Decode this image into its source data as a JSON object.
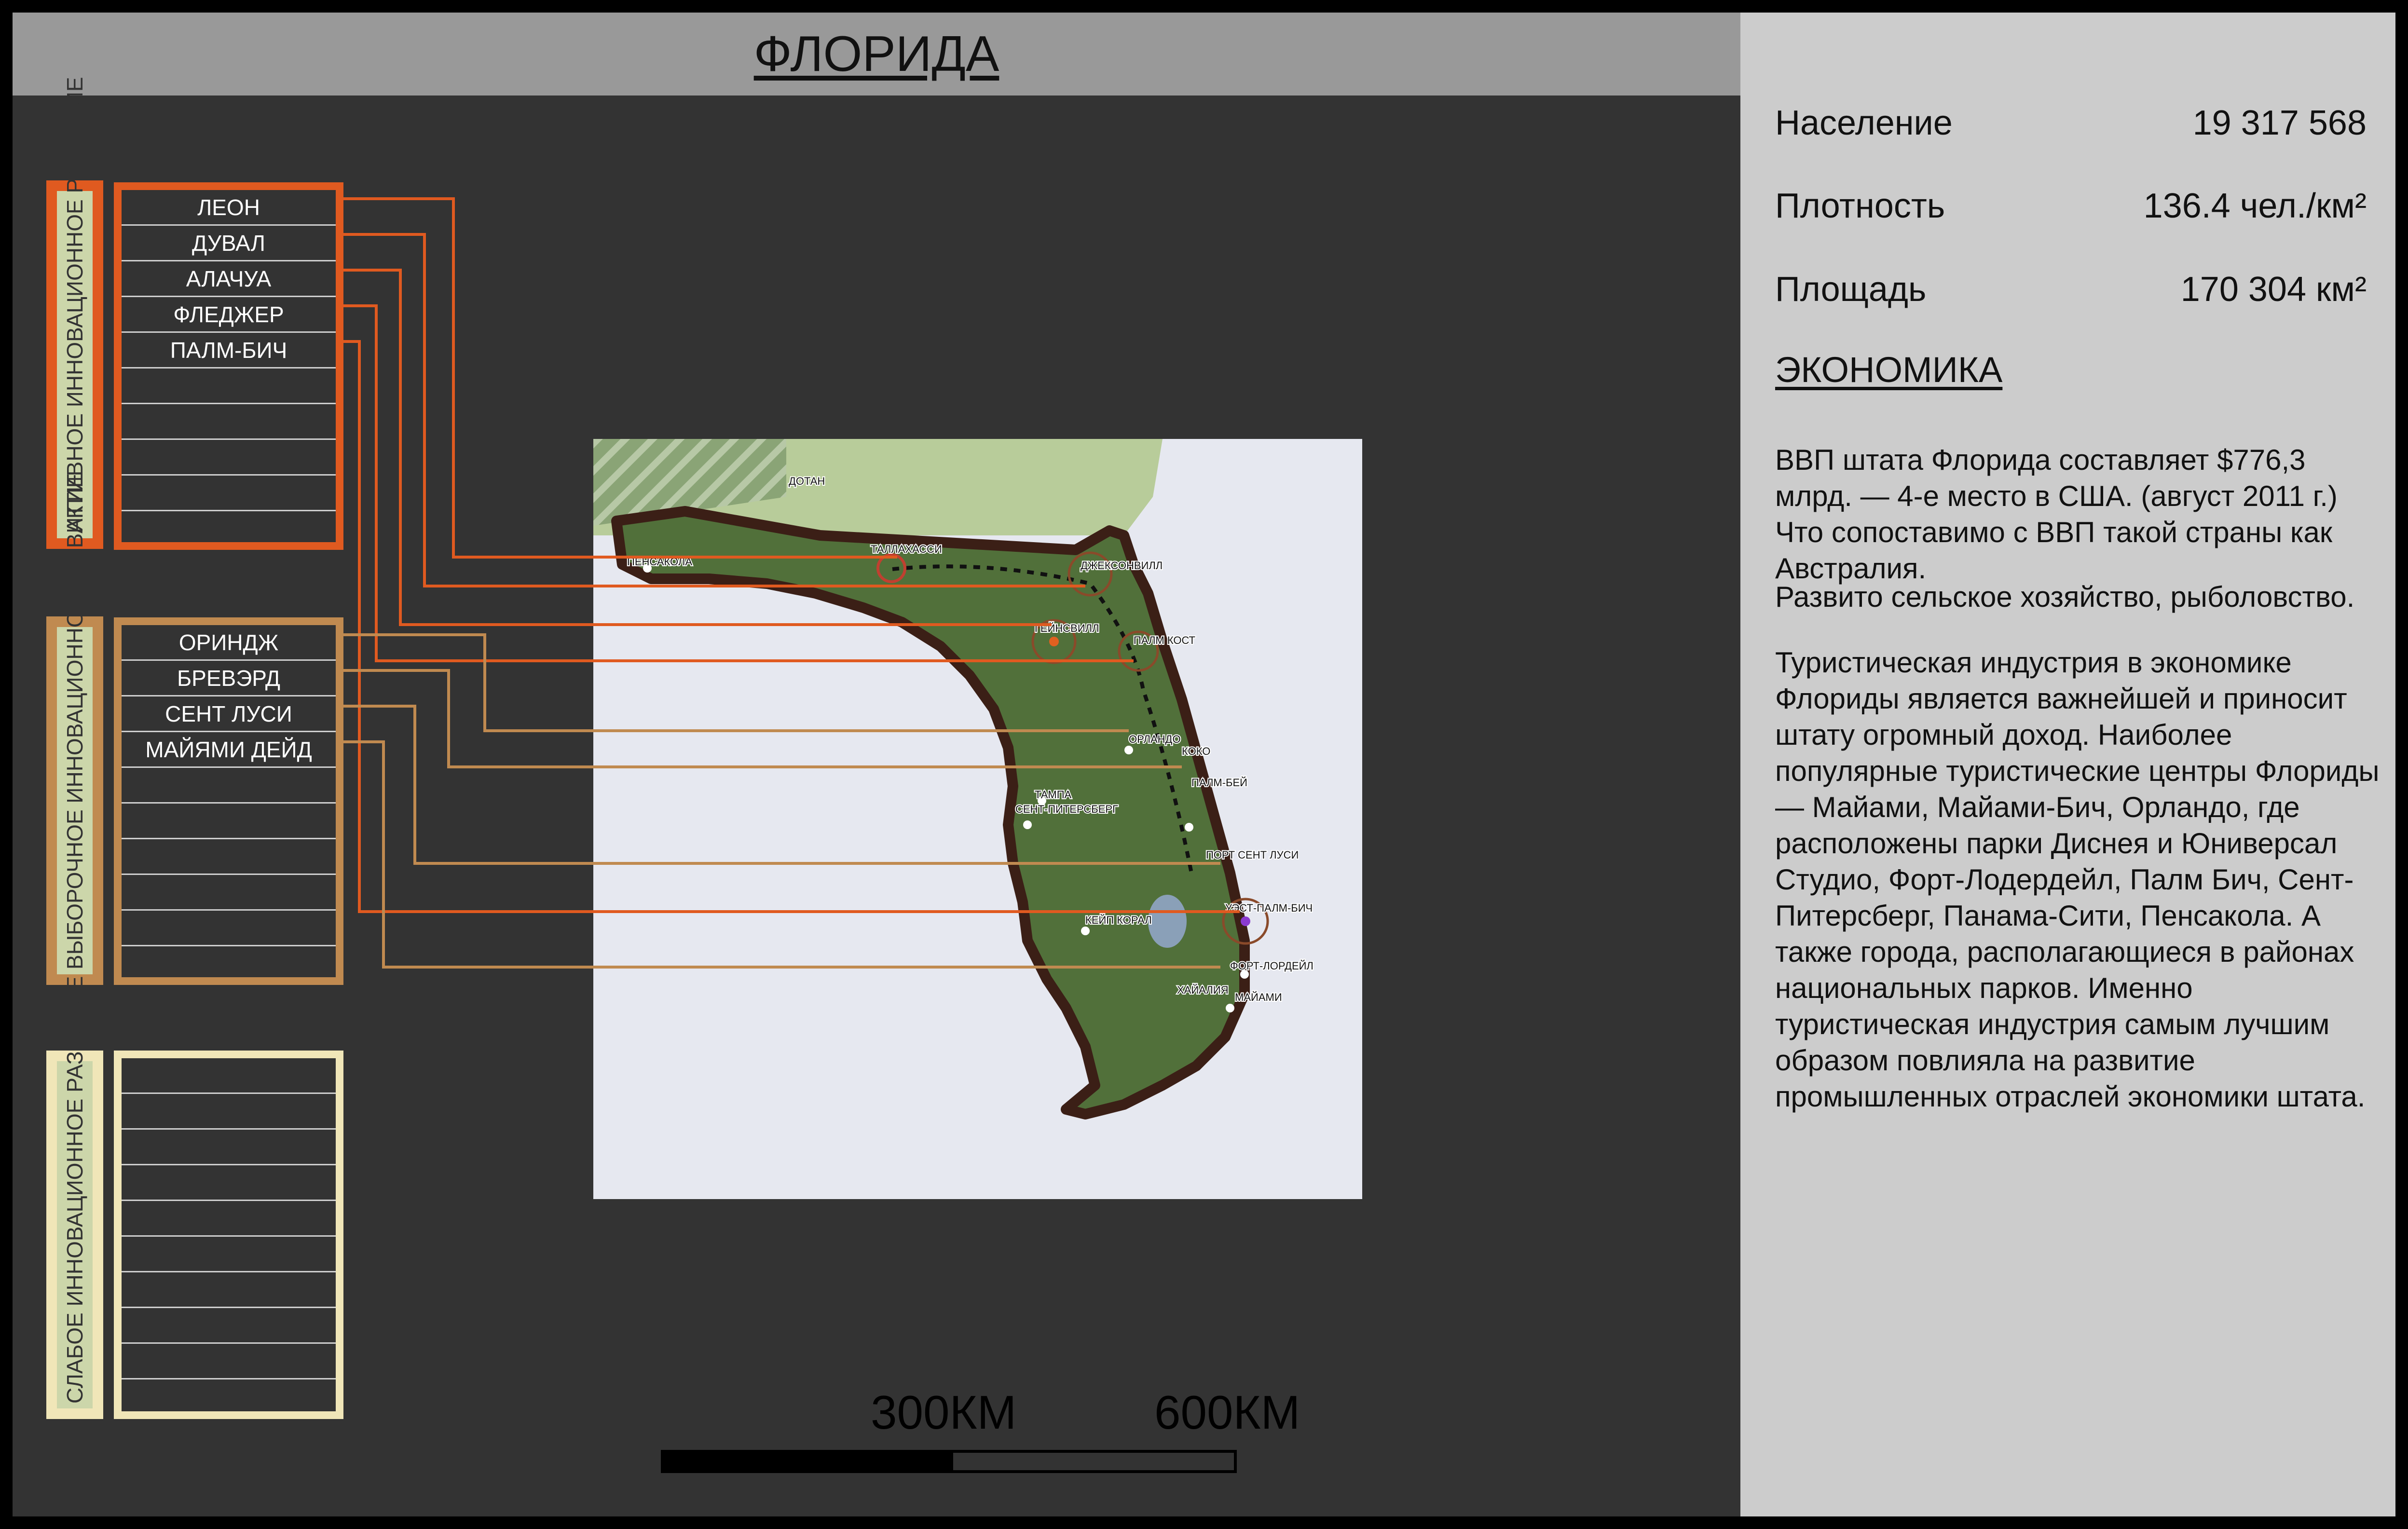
{
  "title": "ФЛОРИДА",
  "stats": [
    {
      "label": "Население",
      "value": "19 317 568"
    },
    {
      "label": "Плотность",
      "value": "136.4 чел./км²"
    },
    {
      "label": "Площадь",
      "value": "170 304 км²"
    }
  ],
  "economy": {
    "title": "ЭКОНОМИКА",
    "paragraphs": [
      "ВВП штата Флорида составляет $776,3 млрд. — 4-е место в США. (август 2011 г.) Что сопоставимо с ВВП такой страны как Австралия.",
      "Развито сельское хозяйство, рыболовство.",
      "Туристическая индустрия в экономике Флориды является важнейшей и приносит штату огромный доход. Наиболее популярные туристические центры Флориды — Майами, Майами-Бич, Орландо, где расположены парки Диснея и Юниверсал Студио, Форт-Лодердейл, Палм Бич, Сент-Питерсберг, Панама-Сити, Пенсакола. А также города, располагающиеся в районах национальных парков. Именно туристическая индустрия самым лучшим образом повлияла на развитие промышленных отраслей экономики штата."
    ]
  },
  "categories": [
    {
      "label": "АКТИВНОЕ ИННОВАЦИОННОЕ РАЗВИТИЕ",
      "color": "#e05a20",
      "items": [
        "ЛЕОН",
        "ДУВАЛ",
        "АЛАЧУА",
        "ФЛЕДЖЕР",
        "ПАЛМ-БИЧ"
      ]
    },
    {
      "label": "ВЫБОРОЧНОЕ ИННОВАЦИОННОЕ РАЗВИТИЕ",
      "color": "#c08a50",
      "items": [
        "ОРИНДЖ",
        "БРЕВЭРД",
        "СЕНТ ЛУСИ",
        "МАЙЯМИ ДЕЙД"
      ]
    },
    {
      "label": "СЛАБОЕ ИННОВАЦИОННОЕ РАЗВИТИЕ",
      "color": "#f0e6b8",
      "items": []
    }
  ],
  "map": {
    "cities": [
      "ТАЛЛАХАССИ",
      "ДЖЕКСОНВИЛЛ",
      "ГЕЙНСВИЛЛ",
      "ПАЛМ КОСТ",
      "ОРЛАНДО",
      "КОКО",
      "ПАЛМ-БЕЙ",
      "ТАМПА",
      "СЕНТ-ПИТЕРСБЕРГ",
      "ПОРТ СЕНТ ЛУСИ",
      "УЭСТ-ПАЛМ-БИЧ",
      "КЕЙП КОРАЛ",
      "ФОРТ-ЛОРДЕЙЛ",
      "ХАЙАЛИЯ",
      "МАЙАМИ",
      "ПЕНСАКОЛА",
      "ДОТАН"
    ]
  },
  "scale": {
    "label_1": "300КМ",
    "label_2": "600КМ"
  }
}
